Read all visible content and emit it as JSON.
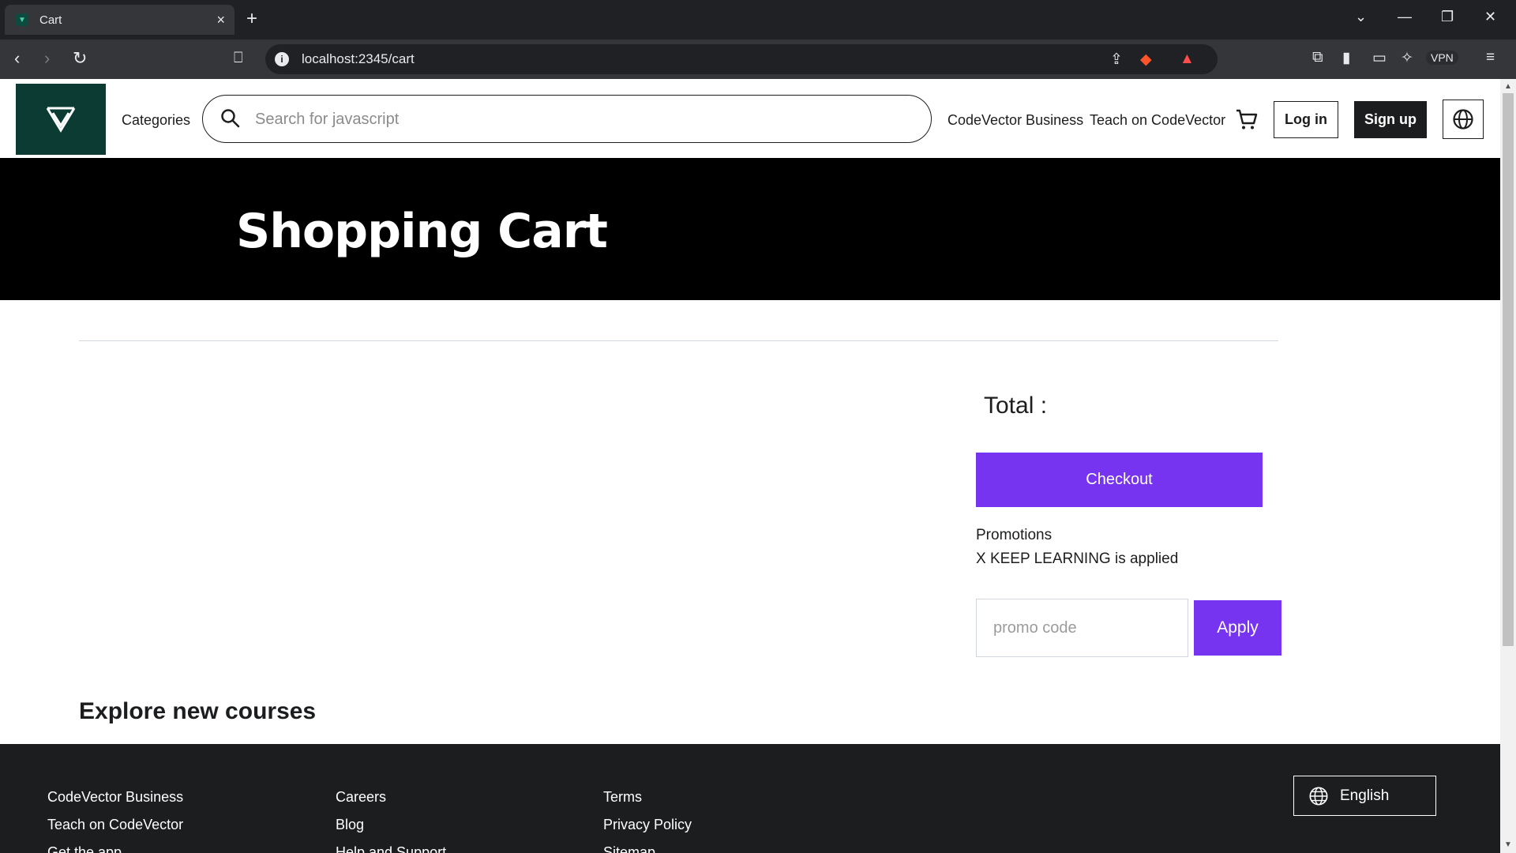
{
  "browser": {
    "tab_title": "Cart",
    "tab_close": "×",
    "new_tab": "+",
    "url": "localhost:2345/cart",
    "vpn_label": "VPN"
  },
  "header": {
    "categories": "Categories",
    "search_placeholder": "Search for javascript",
    "business_link": "CodeVector Business",
    "teach_link": "Teach on CodeVector",
    "login": "Log in",
    "signup": "Sign up"
  },
  "hero": {
    "title": "Shopping Cart"
  },
  "cart": {
    "total_label": "Total :",
    "checkout": "Checkout",
    "promotions_title": "Promotions",
    "promo_applied": "X KEEP LEARNING is applied",
    "promo_placeholder": "promo code",
    "apply": "Apply"
  },
  "explore_title": "Explore new courses",
  "footer": {
    "col1": [
      "CodeVector Business",
      "Teach on CodeVector",
      "Get the app"
    ],
    "col2": [
      "Careers",
      "Blog",
      "Help and Support"
    ],
    "col3": [
      "Terms",
      "Privacy Policy",
      "Sitemap"
    ],
    "language": "English"
  },
  "colors": {
    "accent": "#7634f0",
    "logo_bg": "#0b3b33",
    "hero_bg": "#000000",
    "footer_bg": "#1c1d1f"
  }
}
